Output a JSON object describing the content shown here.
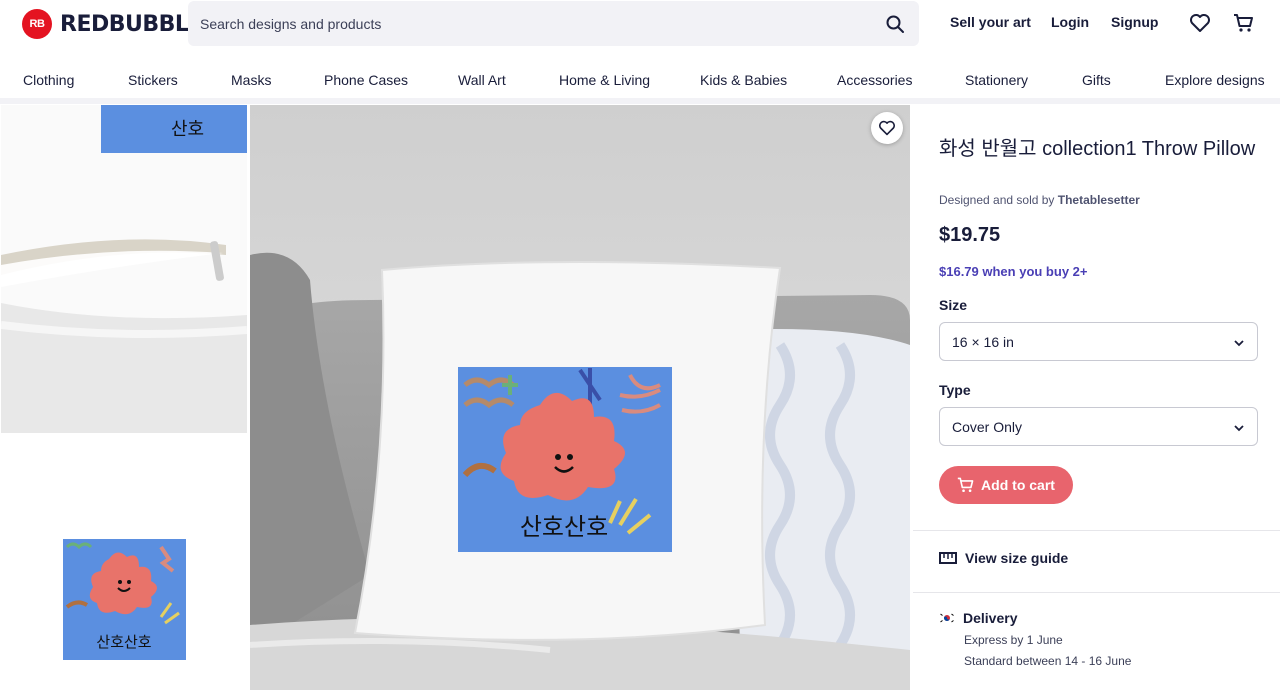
{
  "header": {
    "logo_badge": "RB",
    "logo_text": "REDBUBBLE",
    "search_placeholder": "Search designs and products",
    "links": [
      "Sell your art",
      "Login",
      "Signup"
    ]
  },
  "categories": [
    "Clothing",
    "Stickers",
    "Masks",
    "Phone Cases",
    "Wall Art",
    "Home & Living",
    "Kids & Babies",
    "Accessories",
    "Stationery",
    "Gifts",
    "Explore designs"
  ],
  "artwork": {
    "text": "산호산호"
  },
  "product": {
    "title": "화성 반월고 collection1 Throw Pillow",
    "designed_by_prefix": "Designed and sold by",
    "artist": "Thetablesetter",
    "price": "$19.75",
    "bulk_price": "$16.79 when you buy 2+",
    "size_label": "Size",
    "size_value": "16 × 16 in",
    "type_label": "Type",
    "type_value": "Cover Only",
    "add_to_cart": "Add to cart",
    "size_guide": "View size guide",
    "delivery_title": "Delivery",
    "delivery_express": "Express by 1 June",
    "delivery_standard": "Standard between 14 - 16 June"
  },
  "colors": {
    "brand": "#e41321",
    "accent_button": "#e8646d",
    "bulk_text": "#4a3fb5",
    "art_bg": "#5b8fe0",
    "coral": "#e8736a"
  },
  "icons": [
    "search-icon",
    "heart-icon",
    "cart-icon",
    "chevron-down-icon",
    "ruler-icon",
    "korea-flag-icon"
  ]
}
